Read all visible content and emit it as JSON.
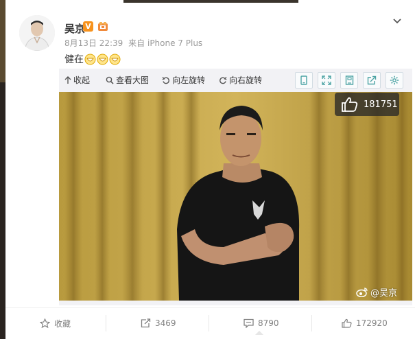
{
  "post": {
    "author": "吴京",
    "verified_badge": "V",
    "date": "8月13日 22:39",
    "source_prefix": "来自",
    "source_device": "iPhone 7 Plus",
    "text": "健在",
    "emoji_count": 3
  },
  "toolbar": {
    "collapse_label": "收起",
    "view_large_label": "查看大图",
    "rotate_left_label": "向左旋转",
    "rotate_right_label": "向右旋转"
  },
  "photo": {
    "like_count": "181751",
    "watermark": "@吴京"
  },
  "actions": {
    "favorite_label": "收藏",
    "repost_count": "3469",
    "comment_count": "8790",
    "like_count": "172920"
  },
  "colors": {
    "accent_orange": "#f7931e",
    "text_primary": "#333333",
    "text_muted": "#999999",
    "toolbar_bg": "#f2f2f5",
    "icon_teal": "#4ba3a3"
  },
  "icons": [
    "chevron-down-icon",
    "magnifier-icon",
    "rotate-left-icon",
    "rotate-right-icon",
    "thumb-up-icon",
    "star-icon",
    "repost-icon",
    "comment-icon",
    "weibo-logo-icon"
  ]
}
